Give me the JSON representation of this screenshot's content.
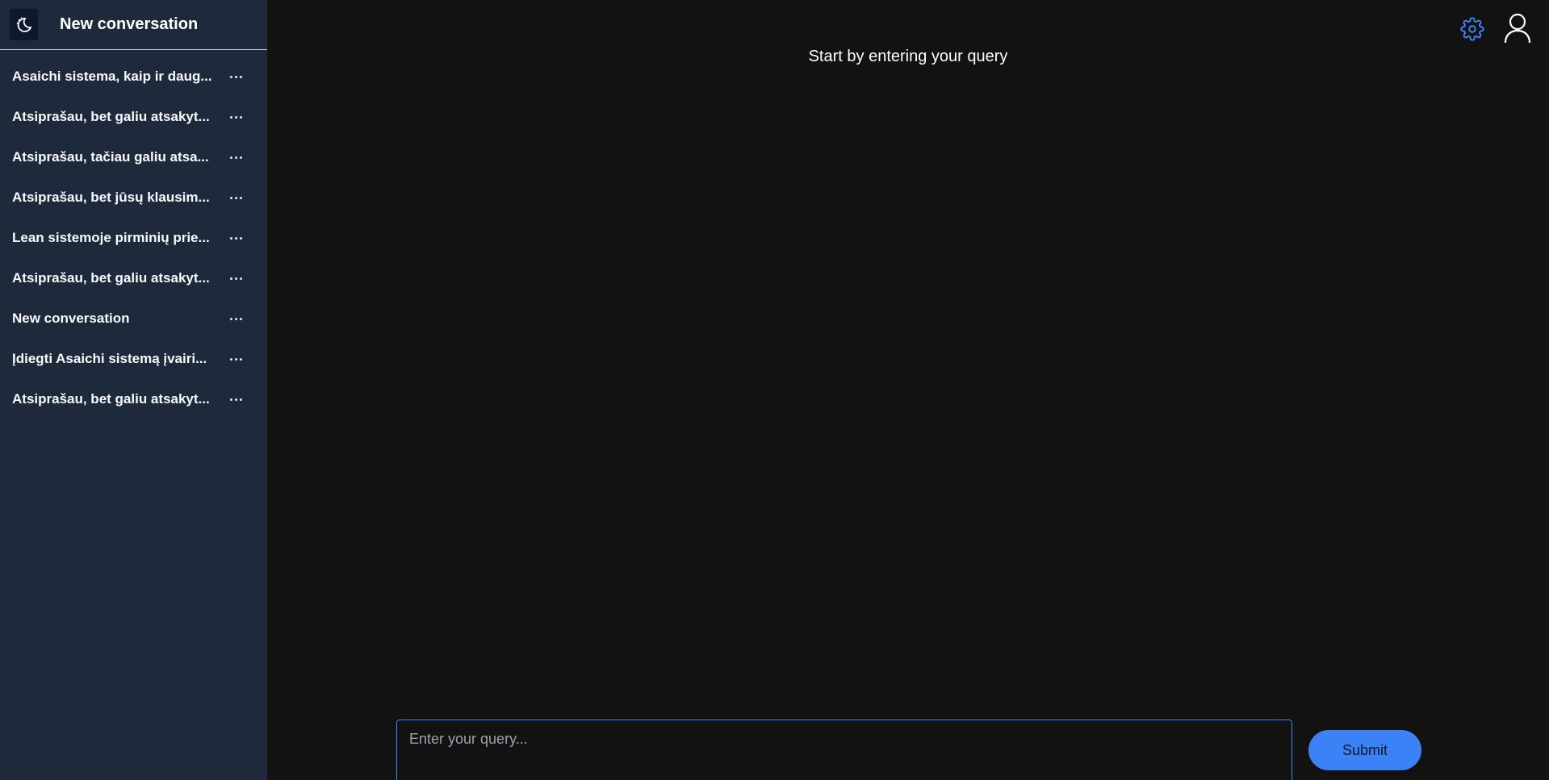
{
  "sidebar": {
    "header_title": "New conversation",
    "logo_icon": "moon-stars-icon",
    "conversations": [
      {
        "label": "Asaichi sistema, kaip ir daug..."
      },
      {
        "label": "Atsiprašau, bet galiu atsakyt..."
      },
      {
        "label": "Atsiprašau, tačiau galiu atsa..."
      },
      {
        "label": "Atsiprašau, bet jūsų klausim..."
      },
      {
        "label": "Lean sistemoje pirminių prie..."
      },
      {
        "label": "Atsiprašau, bet galiu atsakyt..."
      },
      {
        "label": "New conversation"
      },
      {
        "label": "Įdiegti Asaichi sistemą įvairi..."
      },
      {
        "label": "Atsiprašau, bet galiu atsakyt..."
      }
    ]
  },
  "main": {
    "heading": "Start by entering your query",
    "query_placeholder": "Enter your query...",
    "query_value": "",
    "submit_label": "Submit"
  },
  "toolbar": {
    "settings_icon": "gear-icon",
    "user_icon": "user-icon"
  },
  "colors": {
    "background": "#121212",
    "sidebar": "#1e293b",
    "accent": "#3b82f6"
  }
}
